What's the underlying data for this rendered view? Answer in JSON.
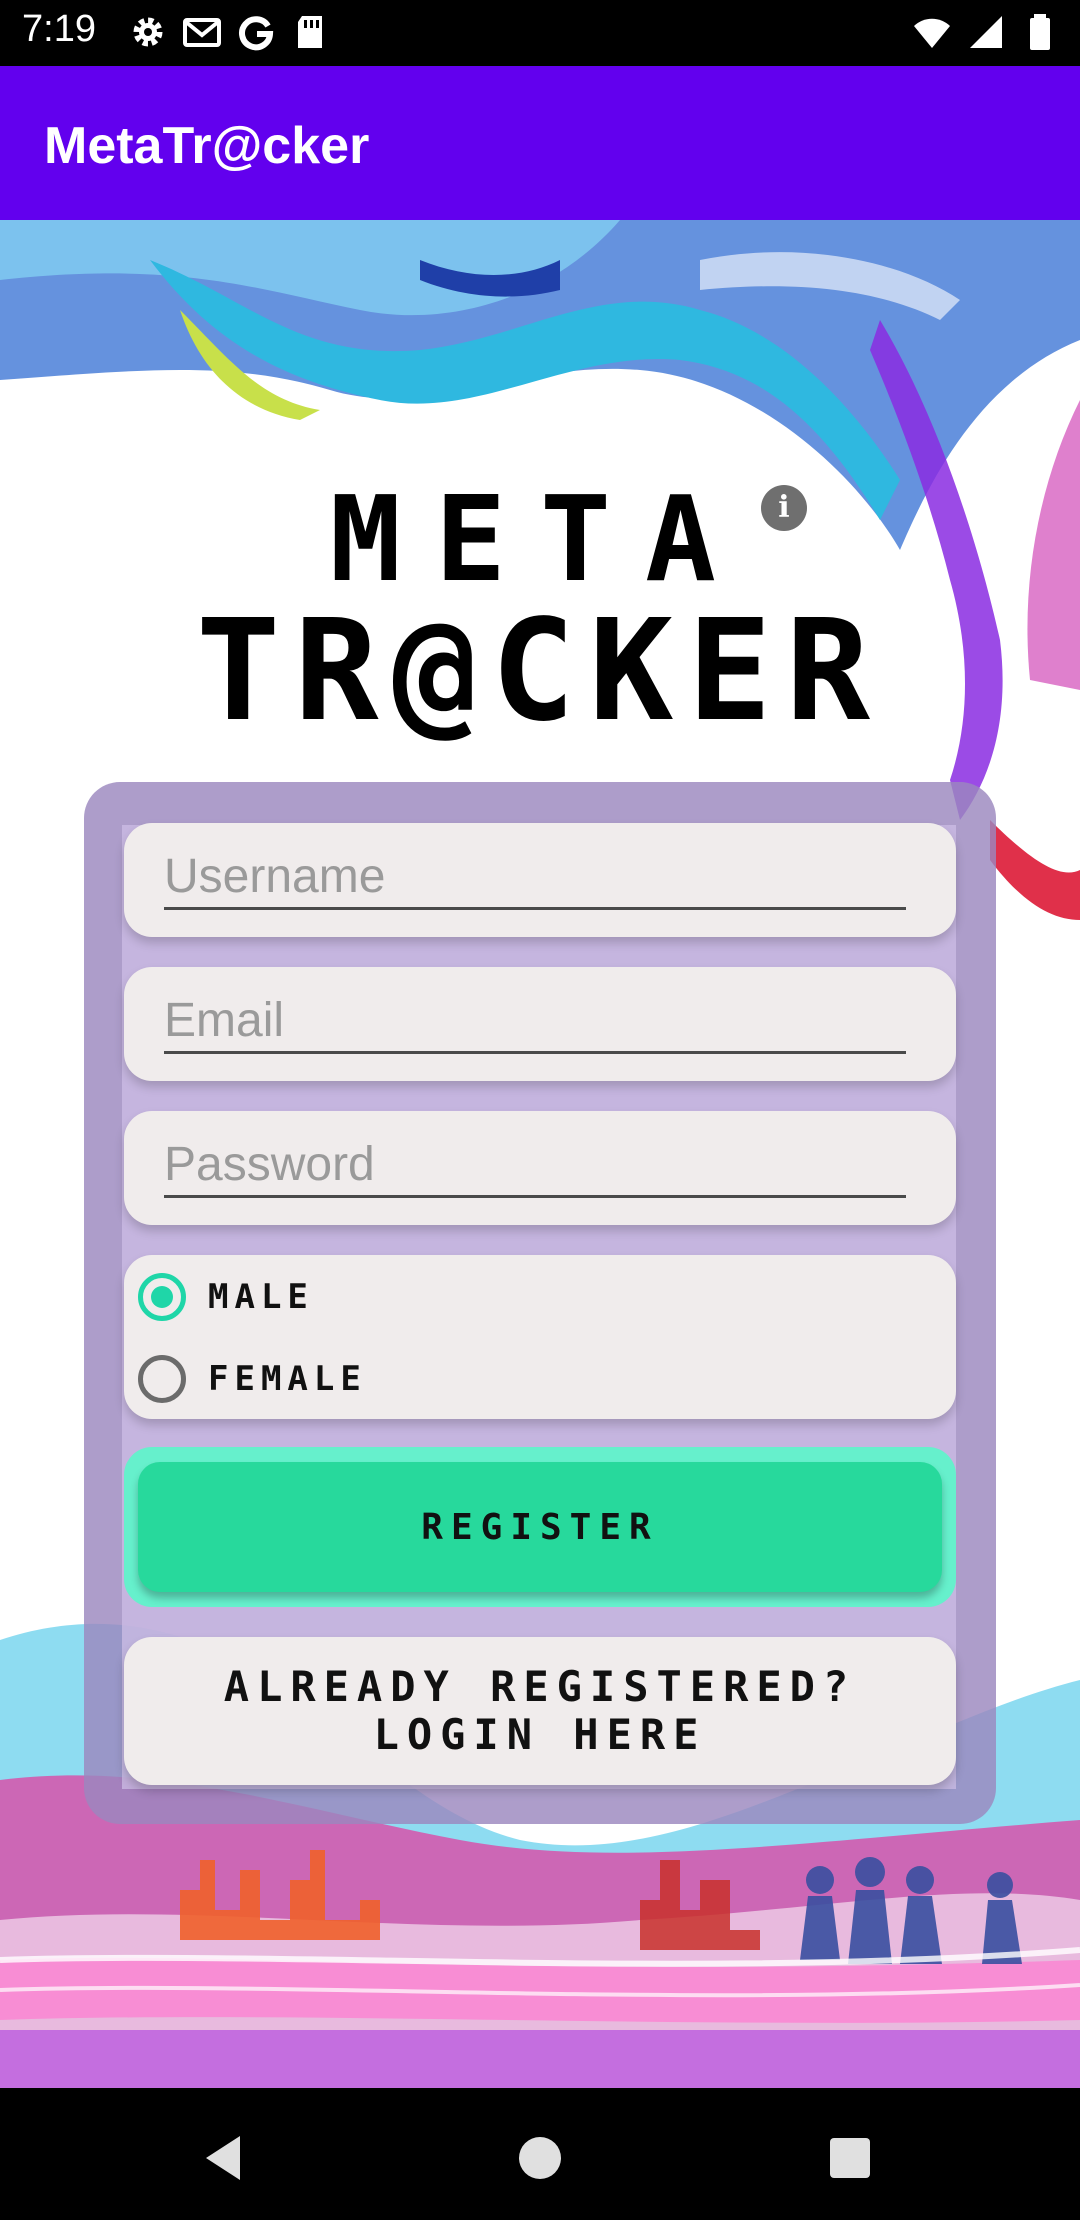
{
  "status_bar": {
    "time": "7:19",
    "left_icons": [
      "settings-icon",
      "gmail-icon",
      "google-icon",
      "sd-card-icon"
    ],
    "right_icons": [
      "wifi-icon",
      "signal-icon",
      "battery-icon"
    ]
  },
  "app_bar": {
    "title": "MetaTr@cker",
    "color": "#6200ee"
  },
  "logo": {
    "line1": "META",
    "line2": "TR@CKER"
  },
  "info": {
    "glyph": "i"
  },
  "form": {
    "username_placeholder": "Username",
    "email_placeholder": "Email",
    "password_placeholder": "Password",
    "gender": {
      "options": [
        "MALE",
        "FEMALE"
      ],
      "selected": "MALE"
    },
    "register_label": "REGISTER",
    "login_label": "ALREADY REGISTERED?\nLOGIN HERE"
  },
  "colors": {
    "accent": "#27d99c",
    "panel": "#9b87be",
    "field_bg": "#f0ecec"
  },
  "nav_bar": {
    "buttons": [
      "back-icon",
      "home-icon",
      "recents-icon"
    ]
  }
}
